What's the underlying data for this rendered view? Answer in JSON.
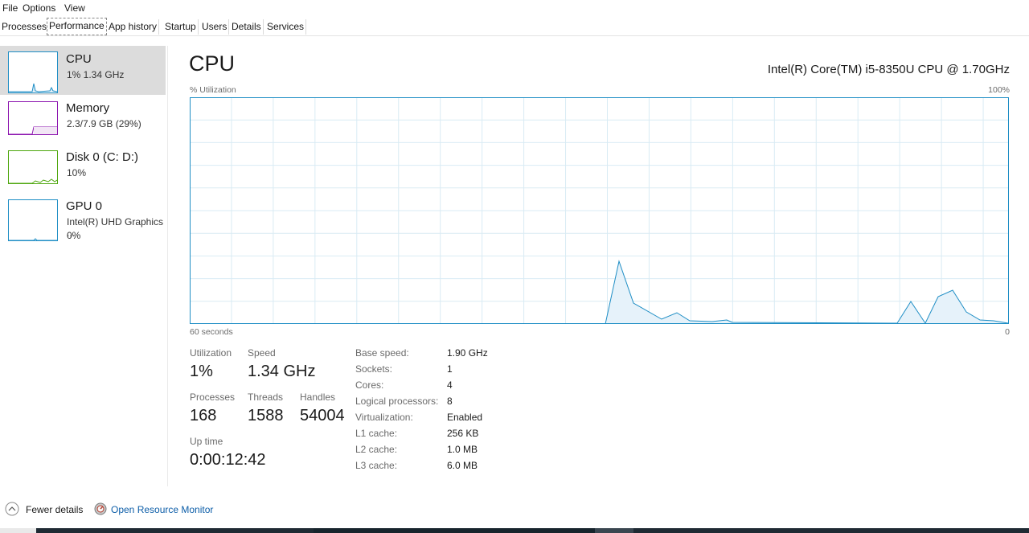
{
  "menu": [
    "File",
    "Options",
    "View"
  ],
  "tabs": [
    "Processes",
    "Performance",
    "App history",
    "Startup",
    "Users",
    "Details",
    "Services"
  ],
  "sidebar": {
    "items": [
      {
        "title": "CPU",
        "lines": [
          "1% 1.34 GHz"
        ]
      },
      {
        "title": "Memory",
        "lines": [
          "2.3/7.9 GB (29%)"
        ]
      },
      {
        "title": "Disk 0 (C: D:)",
        "lines": [
          "10%"
        ]
      },
      {
        "title": "GPU 0",
        "lines": [
          "Intel(R) UHD Graphics ...",
          "0%"
        ]
      }
    ]
  },
  "main": {
    "title": "CPU",
    "model": "Intel(R) Core(TM) i5-8350U CPU @ 1.70GHz",
    "graph": {
      "ylabel": "% Utilization",
      "ymax_label": "100%",
      "xlabel_left": "60 seconds",
      "xlabel_right": "0",
      "color": "#1f8ec5"
    },
    "stats": {
      "utilization_label": "Utilization",
      "utilization": "1%",
      "speed_label": "Speed",
      "speed": "1.34 GHz",
      "processes_label": "Processes",
      "processes": "168",
      "threads_label": "Threads",
      "threads": "1588",
      "handles_label": "Handles",
      "handles": "54004",
      "uptime_label": "Up time",
      "uptime": "0:00:12:42"
    },
    "specs": [
      {
        "label": "Base speed:",
        "value": "1.90 GHz"
      },
      {
        "label": "Sockets:",
        "value": "1"
      },
      {
        "label": "Cores:",
        "value": "4"
      },
      {
        "label": "Logical processors:",
        "value": "8"
      },
      {
        "label": "Virtualization:",
        "value": "Enabled"
      },
      {
        "label": "L1 cache:",
        "value": "256 KB"
      },
      {
        "label": "L2 cache:",
        "value": "1.0 MB"
      },
      {
        "label": "L3 cache:",
        "value": "6.0 MB"
      }
    ]
  },
  "footer": {
    "fewer_details": "Fewer details",
    "resource_monitor": "Open Resource Monitor"
  },
  "colors": {
    "cpu": "#1f8ec5",
    "memory": "#8b12ae",
    "disk": "#4da60c",
    "gpu": "#1f8ec5"
  }
}
